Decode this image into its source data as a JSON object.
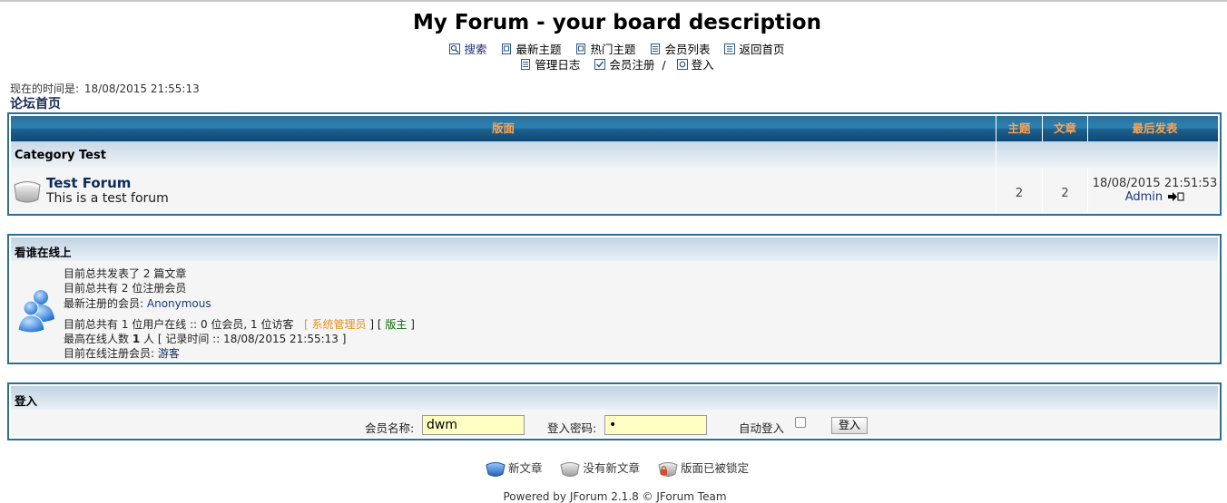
{
  "board": {
    "title": "My Forum - your board description"
  },
  "nav": {
    "row1": [
      {
        "label": "搜索",
        "icon": "search-icon"
      },
      {
        "label": "最新主题",
        "icon": "document-icon"
      },
      {
        "label": "热门主题",
        "icon": "document-icon"
      },
      {
        "label": "会员列表",
        "icon": "list-icon"
      },
      {
        "label": "返回首页",
        "icon": "home-icon"
      }
    ],
    "row2": [
      {
        "label": "管理日志",
        "icon": "log-icon"
      },
      {
        "label": "会员注册",
        "icon": "checkbox-icon"
      },
      {
        "sep": "/"
      },
      {
        "label": "登入",
        "icon": "login-icon"
      }
    ]
  },
  "status": {
    "time_label": "现在的时间是:",
    "time_value": "18/08/2015 21:55:13"
  },
  "breadcrumb": {
    "label": "论坛首页"
  },
  "forum_table": {
    "headers": {
      "forum": "版面",
      "topics": "主题",
      "posts": "文章",
      "last_post": "最后发表"
    },
    "category": "Category Test",
    "forums": [
      {
        "name": "Test Forum",
        "description": "This is a test forum",
        "topics": "2",
        "posts": "2",
        "last_post_date": "18/08/2015 21:51:53",
        "last_post_author": "Admin"
      }
    ]
  },
  "online": {
    "title": "看谁在线上",
    "line1": {
      "prefix": "目前总共发表了",
      "count": "2",
      "suffix": "篇文章"
    },
    "line2": {
      "prefix": "目前总共有",
      "count": "2",
      "suffix": "位注册会员"
    },
    "line3": {
      "prefix": "最新注册的会员:",
      "name": "Anonymous"
    },
    "line4": {
      "text": "目前总共有 1 位用户在线 :: 0 位会员, 1 位访客",
      "open": "[",
      "admin": "系统管理员",
      "mid": "] [",
      "moderator": "版主",
      "close": "]"
    },
    "line5": {
      "prefix": "最高在线人数",
      "count": "1",
      "suffix": "人 [ 记录时间 :: 18/08/2015 21:55:13 ]"
    },
    "line6": {
      "prefix": "目前在线注册会员:",
      "value": "游客"
    }
  },
  "login": {
    "title": "登入",
    "username_label": "会员名称:",
    "username_value": "dwm",
    "password_label": "登入密码:",
    "password_value": "•",
    "autologin_label": "自动登入",
    "autologin_checked": false,
    "submit_label": "登入"
  },
  "legend": [
    {
      "label": "新文章",
      "icon": "new-posts-icon"
    },
    {
      "label": "没有新文章",
      "icon": "no-new-posts-icon"
    },
    {
      "label": "版面已被锁定",
      "icon": "locked-forum-icon"
    }
  ],
  "footer": {
    "powered": "Powered by JForum 2.1.8 © JForum Team"
  },
  "colors": {
    "border": "#2b6e96",
    "header_gradient_mid": "#2a82b3",
    "header_text": "#ffa34f",
    "link": "#0c2a5c",
    "admin": "#e09421",
    "moderator": "#0a6a0a",
    "input_bg": "#ffffc4"
  }
}
